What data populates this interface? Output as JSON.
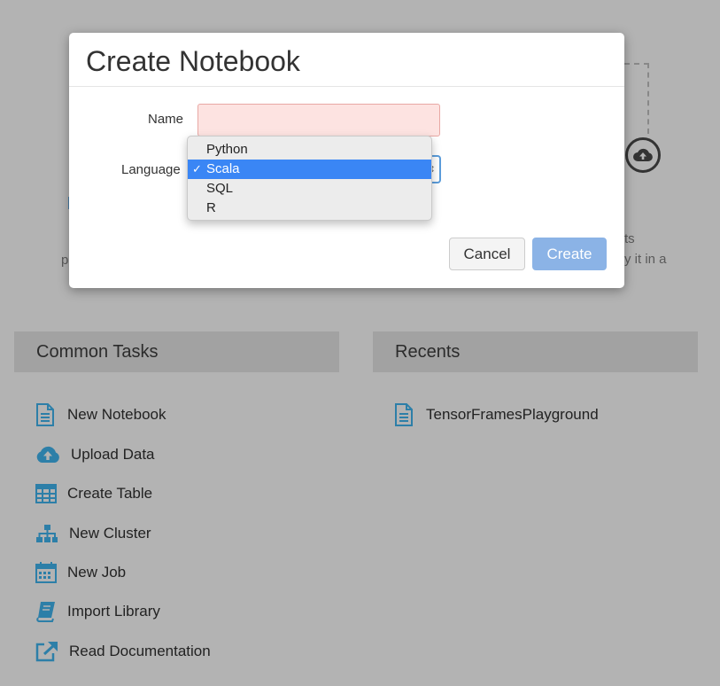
{
  "background": {
    "fragment_ts": "ts",
    "fragment_it_in_a": "y it in a",
    "fragment_p": "p"
  },
  "modal": {
    "title": "Create Notebook",
    "name_label": "Name",
    "name_value": "",
    "language_label": "Language",
    "language_options": [
      "Python",
      "Scala",
      "SQL",
      "R"
    ],
    "language_selected": "Scala",
    "check_mark": "✓",
    "cancel_label": "Cancel",
    "create_label": "Create",
    "colors": {
      "selected_option": "#3a86f5",
      "create_button": "#8bb3e6",
      "name_error_bg": "#fde3e1"
    }
  },
  "common_tasks": {
    "title": "Common Tasks",
    "items": [
      {
        "label": "New Notebook",
        "icon": "notebook-icon"
      },
      {
        "label": "Upload Data",
        "icon": "cloud-upload-icon"
      },
      {
        "label": "Create Table",
        "icon": "table-icon"
      },
      {
        "label": "New Cluster",
        "icon": "cluster-icon"
      },
      {
        "label": "New Job",
        "icon": "calendar-icon"
      },
      {
        "label": "Import Library",
        "icon": "book-icon"
      },
      {
        "label": "Read Documentation",
        "icon": "external-link-icon"
      }
    ]
  },
  "recents": {
    "title": "Recents",
    "items": [
      {
        "label": "TensorFramesPlayground",
        "icon": "notebook-icon"
      }
    ]
  },
  "icon_color": "#2d7fa8"
}
